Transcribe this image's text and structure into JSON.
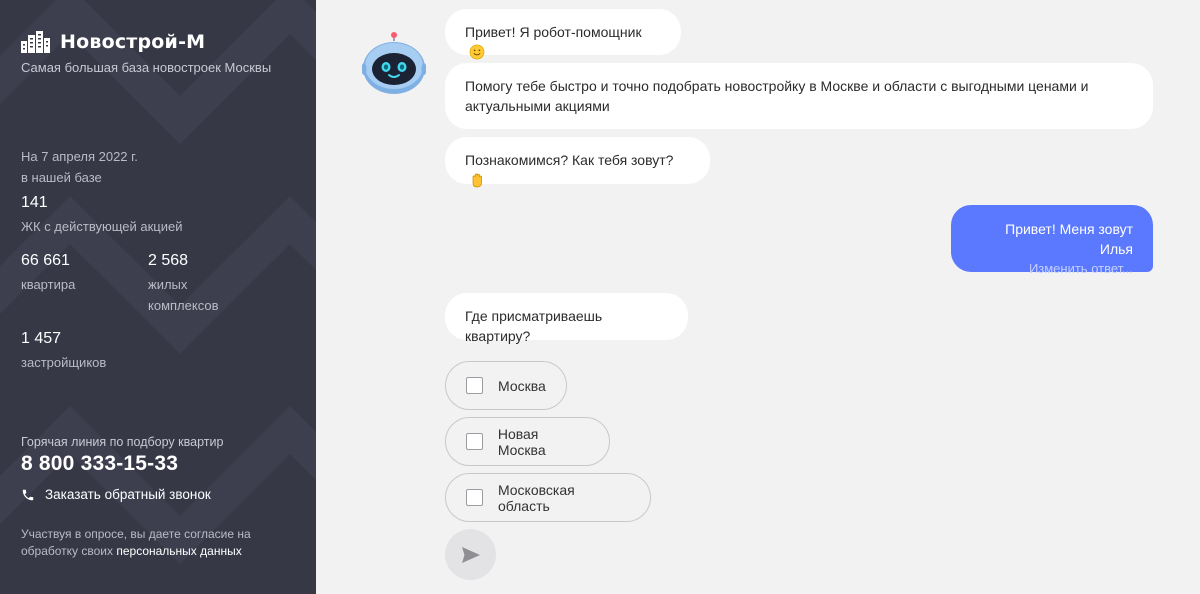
{
  "sidebar": {
    "logo_text": "Новострой-М",
    "tagline": "Самая большая база новостроек Москвы",
    "date_line1": "На 7 апреля 2022 г.",
    "date_line2": "в нашей базе",
    "stats": {
      "promo_count": "141",
      "promo_label": "ЖК с действующей акцией",
      "flats_count": "66 661",
      "flats_label": "квартира",
      "complexes_count": "2 568",
      "complexes_label_1": "жилых",
      "complexes_label_2": "комплексов",
      "developers_count": "1 457",
      "developers_label": "застройщиков"
    },
    "hotline_label": "Горячая линия по подбору квартир",
    "hotline_number": "8 800 333-15-33",
    "callback_label": "Заказать обратный звонок",
    "consent_text": "Участвуя в опросе, вы даете согласие на обработку своих ",
    "consent_link": "персональных данных",
    "colors": {
      "background": "#363846",
      "text": "#ffffff",
      "muted": "#b9bbc6"
    }
  },
  "chat": {
    "bot_avatar_icon": "robot-avatar-icon",
    "messages": [
      {
        "text": "Привет! Я робот-помощник",
        "emoji": "smiling-face-icon"
      },
      {
        "text": "Помогу тебе быстро и точно подобрать новостройку в Москве и области с выгодными ценами и актуальными акциями"
      },
      {
        "text": "Познакомимся? Как тебя зовут?",
        "emoji": "waving-hand-icon"
      },
      {
        "text": "Где присматриваешь квартиру?"
      }
    ],
    "user_reply": {
      "text": "Привет! Меня зовут Илья",
      "edit_label": "Изменить ответ..."
    },
    "options": [
      {
        "label": "Москва",
        "checked": false
      },
      {
        "label": "Новая Москва",
        "checked": false
      },
      {
        "label": "Московская область",
        "checked": false
      }
    ],
    "send_icon": "send-icon",
    "colors": {
      "accent": "#5b79ff",
      "background": "#f2f2f3",
      "bubble": "#ffffff"
    }
  }
}
